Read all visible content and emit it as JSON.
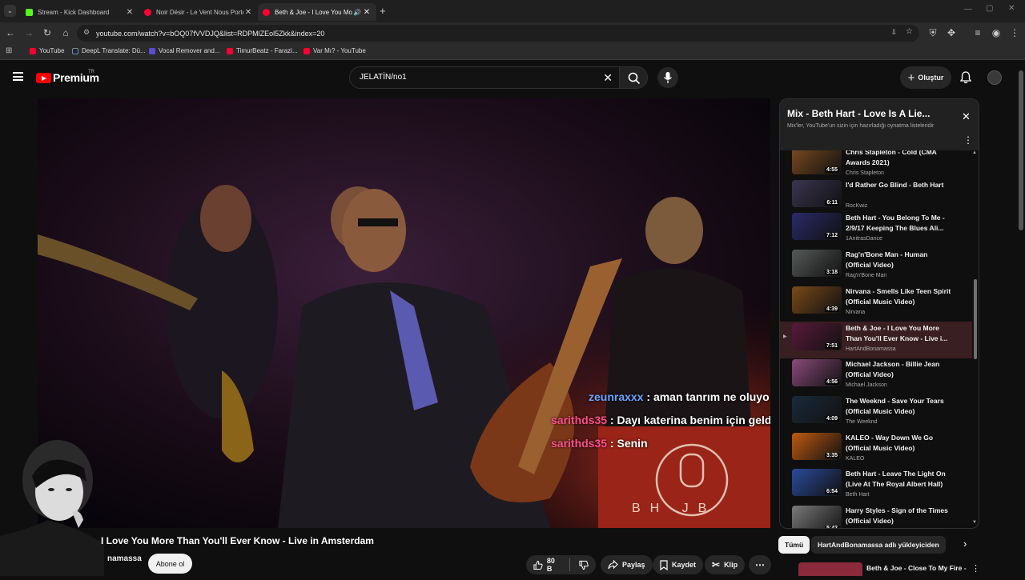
{
  "browser": {
    "tabs": [
      {
        "title": "Stream - Kick Dashboard",
        "color": "#53fc18"
      },
      {
        "title": "Noir Désir - Le Vent Nous Porte",
        "color": "#ff0033"
      },
      {
        "title": "Beth & Joe - I Love You More",
        "color": "#ff0033"
      }
    ],
    "url": "youtube.com/watch?v=bOQ07fVVDJQ&list=RDPMlZEol5Zkk&index=20",
    "bookmarks": [
      {
        "label": "YouTube",
        "color": "#ff0033"
      },
      {
        "label": "DeepL Translate: Dü...",
        "color": "#0f2b46"
      },
      {
        "label": "Vocal Remover and...",
        "color": "#5b4bd6"
      },
      {
        "label": "TimurBeatz - Farazi...",
        "color": "#ff0033"
      },
      {
        "label": "Var Mı? - YouTube",
        "color": "#ff0033"
      }
    ]
  },
  "header": {
    "logo": "Premium",
    "logo_sup": "TR",
    "search_value": "JELATİN/no1",
    "create_label": "Oluştur"
  },
  "chat": [
    {
      "user": "zeunraxxx",
      "sep": " : ",
      "message": "aman tanrım ne oluyo",
      "user_color": "#6aa4ff"
    },
    {
      "user": "sarithds35",
      "sep": " : ",
      "message": "Dayı katerina benim için geldi ama",
      "user_color": "#ff4f8a"
    },
    {
      "user": "sarithds35",
      "sep": " : ",
      "message": "Senin",
      "user_color": "#ff4f8a"
    }
  ],
  "video_logo": "BH JB",
  "video": {
    "title": "I Love You More Than You'll Ever Know - Live in Amsterdam",
    "channel": "namassa",
    "subscribe_label": "Abone ol",
    "like_count": "80 B",
    "share_label": "Paylaş",
    "save_label": "Kaydet",
    "clip_label": "Klip"
  },
  "playlist": {
    "title": "Mix - Beth Hart - Love Is A Lie...",
    "subtitle": "Mix'ler, YouTube'un sizin için hazırladığı oynatma listeleridir",
    "items": [
      {
        "title": "Chris Stapleton - Cold (CMA Awards 2021)",
        "channel": "Chris Stapleton",
        "duration": "4:55",
        "thumb": "#7a4a20"
      },
      {
        "title": "I'd Rather Go Blind - Beth Hart",
        "channel": "RocKwiz",
        "duration": "6:11",
        "thumb": "#3b3550"
      },
      {
        "title": "Beth Hart - You Belong To Me - 2/9/17 Keeping The Blues Ali...",
        "channel": "1AnitrasDance",
        "duration": "7:12",
        "thumb": "#2a2a6a"
      },
      {
        "title": "Rag'n'Bone Man - Human (Official Video)",
        "channel": "Rag'n'Bone Man",
        "duration": "3:18",
        "thumb": "#555a58"
      },
      {
        "title": "Nirvana - Smells Like Teen Spirit (Official Music Video)",
        "channel": "Nirvana",
        "duration": "4:39",
        "thumb": "#7a4a18"
      },
      {
        "title": "Beth & Joe - I Love You More Than You'll Ever Know - Live i...",
        "channel": "HartAndBonamassa",
        "duration": "7:51",
        "thumb": "#5a1a3a"
      },
      {
        "title": "Michael Jackson - Billie Jean (Official Video)",
        "channel": "Michael Jackson",
        "duration": "4:56",
        "thumb": "#8a4a7a"
      },
      {
        "title": "The Weeknd - Save Your Tears (Official Music Video)",
        "channel": "The Weeknd",
        "duration": "4:09",
        "thumb": "#1a2a3a"
      },
      {
        "title": "KALEO - Way Down We Go (Official Music Video)",
        "channel": "KALEO",
        "duration": "3:35",
        "thumb": "#c05a10"
      },
      {
        "title": "Beth Hart - Leave The Light On (Live At The Royal Albert Hall)",
        "channel": "Beth Hart",
        "duration": "6:54",
        "thumb": "#2a4a9a"
      },
      {
        "title": "Harry Styles - Sign of the Times (Official Video)",
        "channel": "",
        "duration": "5:42",
        "thumb": "#7a7a7a"
      }
    ],
    "current_index": 5
  },
  "chips": {
    "all": "Tümü",
    "uploader": "HartAndBonamassa adlı yükleyiciden"
  },
  "below_item": {
    "title": "Beth & Joe - Close To My Fire -"
  }
}
